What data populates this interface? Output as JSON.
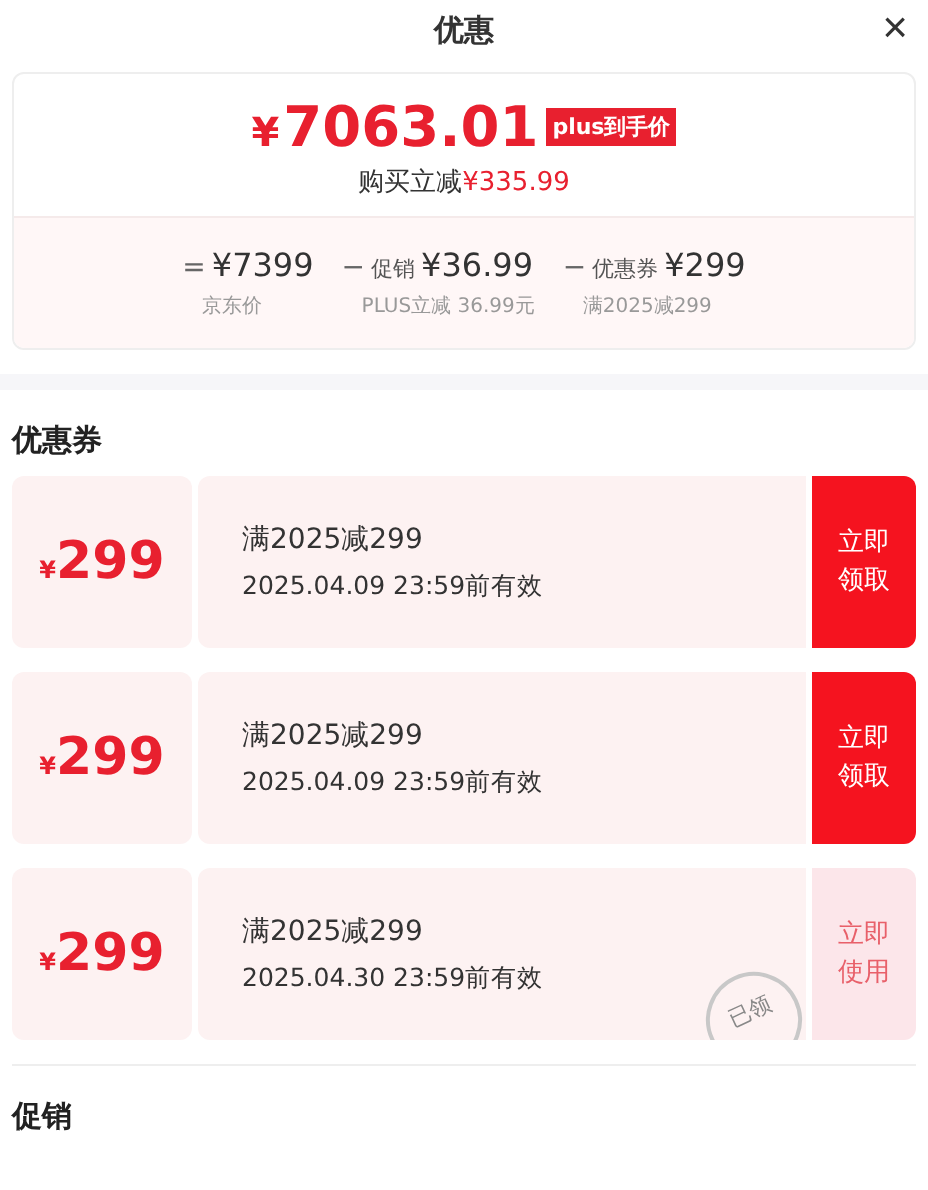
{
  "header": {
    "title": "优惠",
    "close": "×"
  },
  "summary": {
    "currency": "¥",
    "price": "7063.01",
    "badge": "plus到手价",
    "saving_label": "购买立减",
    "saving": "¥335.99",
    "breakdown": [
      {
        "op": "=",
        "amount": "¥7399",
        "note": "京东价"
      },
      {
        "op": "−",
        "label": "促销",
        "amount": "¥36.99",
        "note": "PLUS立减 36.99元"
      },
      {
        "op": "−",
        "label": "优惠券",
        "amount": "¥299",
        "note": "满2025减299"
      }
    ]
  },
  "coupon_section": {
    "title": "优惠券",
    "coupons": [
      {
        "currency": "¥",
        "amount": "299",
        "condition": "满2025减299",
        "validity": "2025.04.09 23:59前有效",
        "action": "立即领取",
        "claimed": false
      },
      {
        "currency": "¥",
        "amount": "299",
        "condition": "满2025减299",
        "validity": "2025.04.09 23:59前有效",
        "action": "立即领取",
        "claimed": false
      },
      {
        "currency": "¥",
        "amount": "299",
        "condition": "满2025减299",
        "validity": "2025.04.30 23:59前有效",
        "action": "立即使用",
        "claimed": true,
        "stamp": "已领"
      }
    ]
  },
  "promo_section": {
    "title": "促销"
  }
}
